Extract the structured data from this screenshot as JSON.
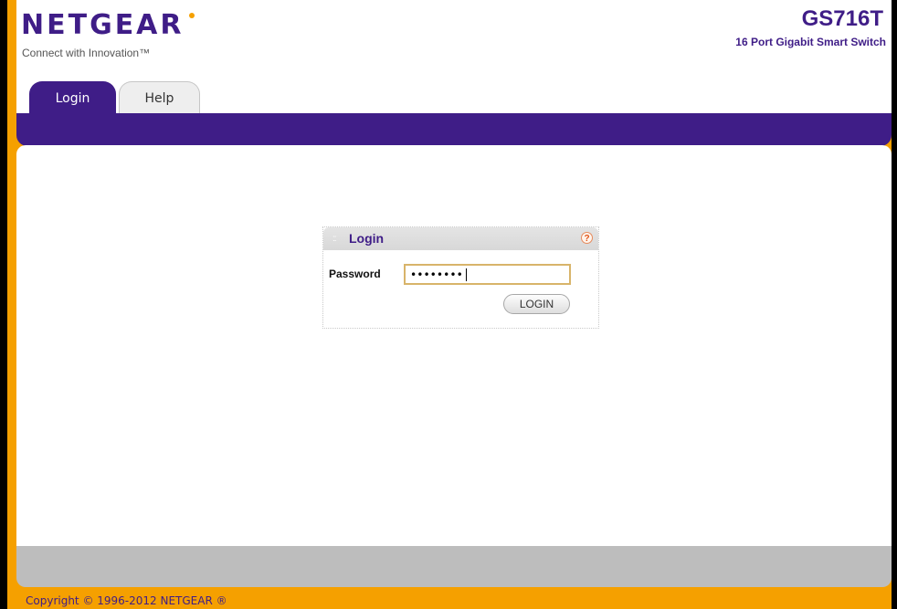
{
  "brand": {
    "logo_text": "NETGEAR",
    "tagline": "Connect with Innovation™",
    "model": "GS716T",
    "model_description": "16 Port Gigabit Smart Switch"
  },
  "tabs": [
    {
      "label": "Login",
      "active": true
    },
    {
      "label": "Help",
      "active": false
    }
  ],
  "login_panel": {
    "title": "Login",
    "help_icon": "?",
    "password_label": "Password",
    "password_value": "••••••••",
    "login_button": "LOGIN"
  },
  "footer": {
    "copyright": "Copyright © 1996-2012 NETGEAR ®"
  },
  "colors": {
    "brand_purple": "#3f1d87",
    "frame_orange": "#f5a000",
    "footer_gray": "#bdbdbd"
  }
}
